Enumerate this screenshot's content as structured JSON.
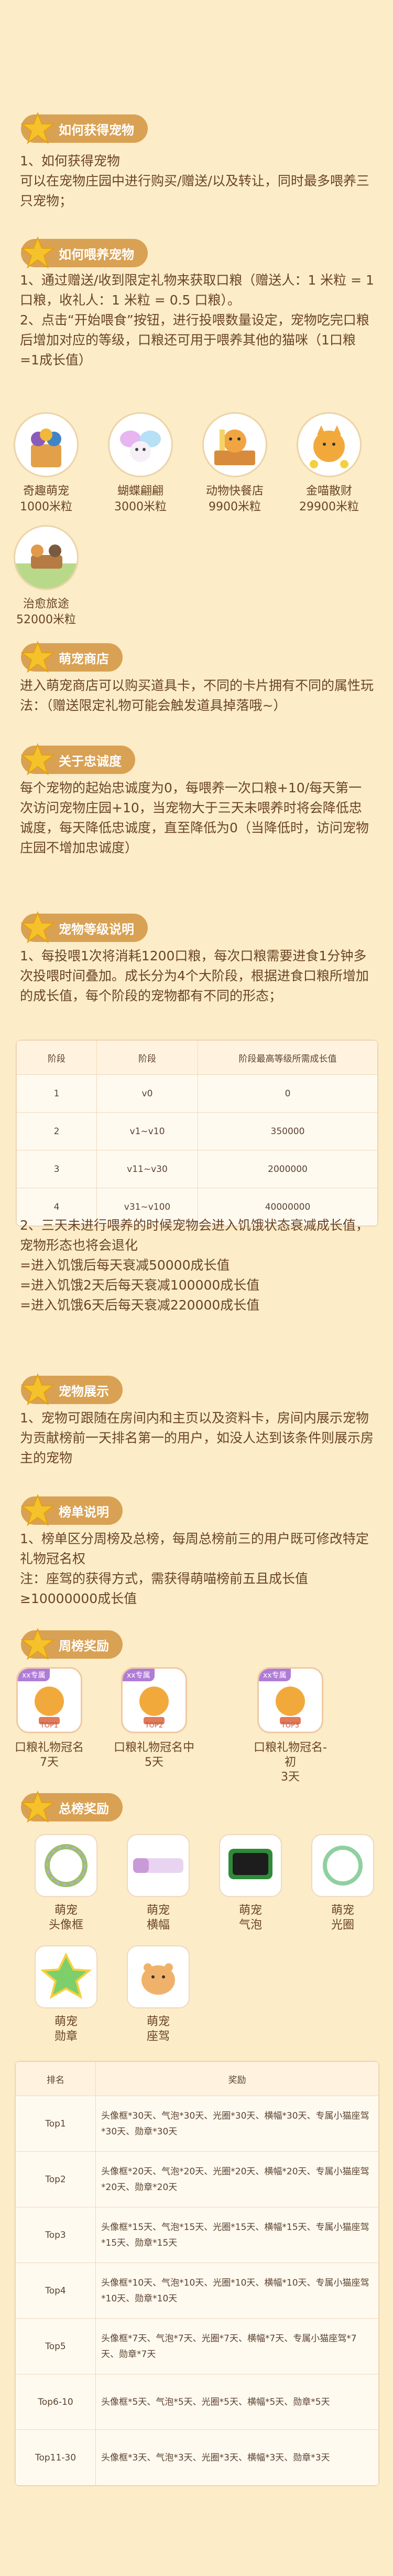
{
  "sections": {
    "how_to_get": {
      "title": "如何获得宠物",
      "lines": [
        "1、如何获得宠物",
        "可以在宠物庄园中进行购买/赠送/以及转让，同时最多喂养三只宠物；"
      ]
    },
    "feed": {
      "title": "如何喂养宠物",
      "lines": [
        "1、通过赠送/收到限定礼物来获取口粮（赠送人：1 米粒 = 1 口粮，收礼人：1 米粒 = 0.5 口粮）。",
        "2、点击“开始喂食”按钮，进行投喂数量设定，宠物吃完口粮后增加对应的等级，口粮还可用于喂养其他的猫咪（1口粮=1成长值）"
      ]
    },
    "gifts": [
      {
        "name": "奇趣萌宠",
        "price": "1000米粒",
        "icon": "cat-basket-icon"
      },
      {
        "name": "蝴蝶翩翩",
        "price": "3000米粒",
        "icon": "butterfly-icon"
      },
      {
        "name": "动物快餐店",
        "price": "9900米粒",
        "icon": "fast-food-icon"
      },
      {
        "name": "金喵散财",
        "price": "29900米粒",
        "icon": "fortune-cat-icon"
      },
      {
        "name": "治愈旅途",
        "price": "52000米粒",
        "icon": "journey-icon"
      }
    ],
    "shop": {
      "title": "萌宠商店",
      "lines": [
        "进入萌宠商店可以购买道具卡，不同的卡片拥有不同的属性玩法：（赠送限定礼物可能会触发道具掉落哦~）"
      ]
    },
    "loyalty": {
      "title": "关于忠诚度",
      "lines": [
        "每个宠物的起始忠诚度为0，每喂养一次口粮+10/每天第一次访问宠物庄园+10，当宠物大于三天未喂养时将会降低忠诚度，每天降低忠诚度，直至降低为0（当降低时，访问宠物庄园不增加忠诚度）"
      ]
    },
    "level": {
      "title": "宠物等级说明",
      "lines": [
        "1、每投喂1次将消耗1200口粮，每次口粮需要进食1分钟多次投喂时间叠加。成长分为4个大阶段，根据进食口粮所增加的成长值，每个阶段的宠物都有不同的形态；"
      ],
      "table": {
        "headers": [
          "阶段",
          "阶段",
          "阶段最高等级所需成长值"
        ],
        "rows": [
          [
            "1",
            "v0",
            "0"
          ],
          [
            "2",
            "v1~v10",
            "350000"
          ],
          [
            "3",
            "v11~v30",
            "2000000"
          ],
          [
            "4",
            "v31~v100",
            "40000000"
          ]
        ]
      },
      "after_lines": [
        "2、三天未进行喂养的时候宠物会进入饥饿状态衰减成长值，宠物形态也将会退化",
        "=进入饥饿后每天衰减50000成长值",
        "=进入饥饿2天后每天衰减100000成长值",
        "=进入饥饿6天后每天衰减220000成长值"
      ]
    },
    "display": {
      "title": "宠物展示",
      "lines": [
        "1、宠物可跟随在房间内和主页以及资料卡，房间内展示宠物为贡献榜前一天排名第一的用户，如没人达到该条件则展示房主的宠物"
      ]
    },
    "rank_desc": {
      "title": "榜单说明",
      "lines": [
        "1、榜单区分周榜及总榜，每周总榜前三的用户既可修改特定礼物冠名权",
        "注：座驾的获得方式，需获得萌喵榜前五且成长值≥10000000成长值"
      ]
    },
    "weekly": {
      "title": "周榜奖励",
      "items": [
        {
          "badge": "xx专属",
          "label": "TOP1",
          "t1": "口粮礼物冠名",
          "t2": "7天",
          "icon": "trophy-cat-icon"
        },
        {
          "badge": "xx专属",
          "label": "TOP2",
          "t1": "口粮礼物冠名中",
          "t2": "5天",
          "icon": "trophy-cat-icon"
        },
        {
          "badge": "xx专属",
          "label": "TOP3",
          "t1": "口粮礼物冠名-初",
          "t2": "3天",
          "icon": "trophy-cat-icon"
        }
      ]
    },
    "total": {
      "title": "总榜奖励",
      "items": [
        {
          "t1": "萌宠",
          "t2": "头像框",
          "icon": "wreath-frame-icon"
        },
        {
          "t1": "萌宠",
          "t2": "横幅",
          "icon": "banner-icon"
        },
        {
          "t1": "萌宠",
          "t2": "气泡",
          "icon": "chat-bubble-icon"
        },
        {
          "t1": "萌宠",
          "t2": "光圈",
          "icon": "halo-icon"
        },
        {
          "t1": "萌宠",
          "t2": "勋章",
          "icon": "medal-icon"
        },
        {
          "t1": "萌宠",
          "t2": "座驾",
          "icon": "hamster-mount-icon"
        }
      ],
      "table": {
        "headers": [
          "排名",
          "奖励"
        ],
        "rows": [
          [
            "Top1",
            "头像框*30天、气泡*30天、光圈*30天、横幅*30天、专属小猫座驾*30天、勋章*30天"
          ],
          [
            "Top2",
            "头像框*20天、气泡*20天、光圈*20天、横幅*20天、专属小猫座驾*20天、勋章*20天"
          ],
          [
            "Top3",
            "头像框*15天、气泡*15天、光圈*15天、横幅*15天、专属小猫座驾*15天、勋章*15天"
          ],
          [
            "Top4",
            "头像框*10天、气泡*10天、光圈*10天、横幅*10天、专属小猫座驾*10天、勋章*10天"
          ],
          [
            "Top5",
            "头像框*7天、气泡*7天、光圈*7天、横幅*7天、专属小猫座驾*7天、勋章*7天"
          ],
          [
            "Top6-10",
            "头像框*5天、气泡*5天、光圈*5天、横幅*5天、勋章*5天"
          ],
          [
            "Top11-30",
            "头像框*3天、气泡*3天、光圈*3天、横幅*3天、勋章*3天"
          ]
        ]
      }
    }
  },
  "colors": {
    "background": "#fcecc8",
    "tag": "#d9a153",
    "text": "#6a4424",
    "star": "#f6c22b"
  }
}
